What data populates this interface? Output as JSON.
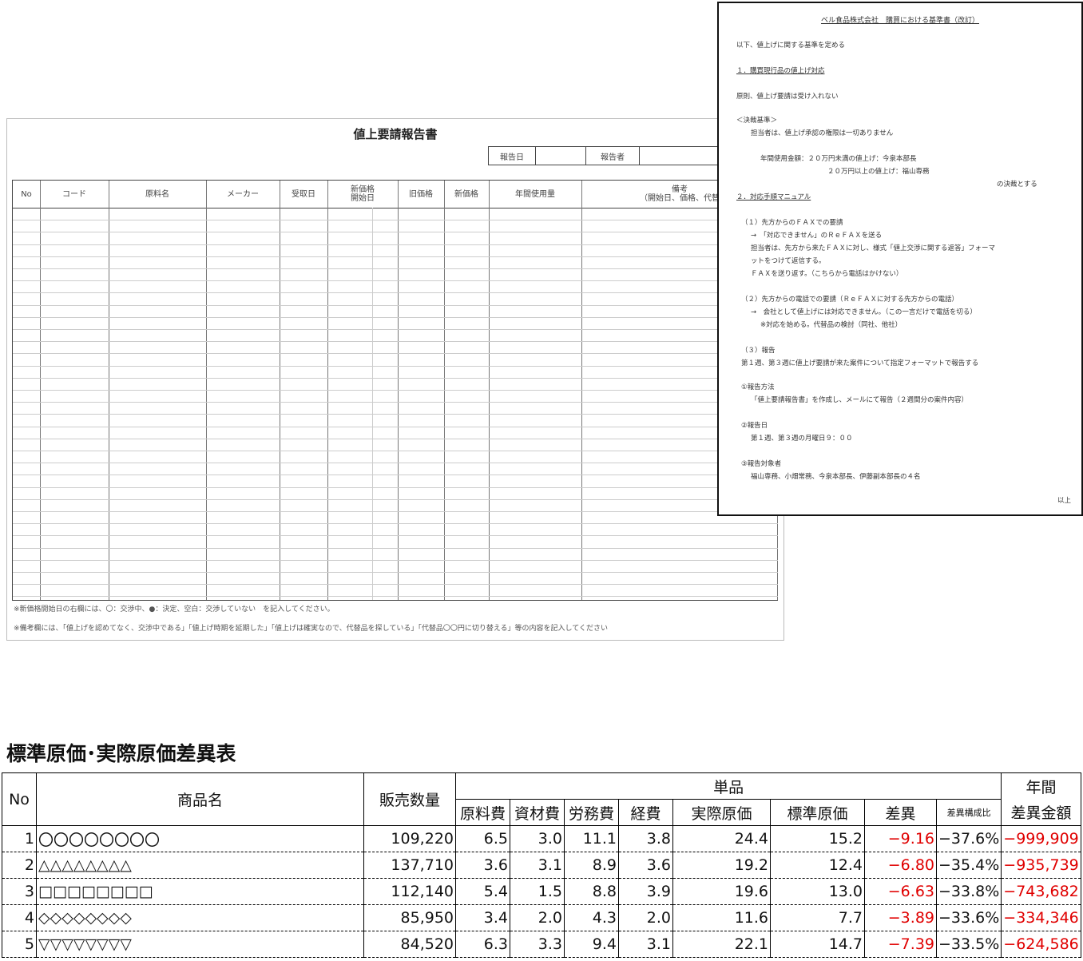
{
  "form": {
    "title": "値上要請報告書",
    "report_date_label": "報告日",
    "reporter_label": "報告者",
    "columns": [
      "No",
      "コード",
      "原料名",
      "メーカー",
      "受取日",
      "新価格\n開始日",
      "旧価格",
      "新価格",
      "年間使用量",
      "備考\n（開始日、価格、代替"
    ],
    "note1": "※新価格開始日の右欄には、〇：交渉中、●：決定、空白：交渉していない　を記入してください。",
    "note2": "※備考欄には、「値上げを認めてなく、交渉中である」「値上げ時期を延期した」「値上げは確実なので、代替品を探している」「代替品〇〇円に切り替える」等の内容を記入してください"
  },
  "doc": {
    "title": "ベル食品株式会社　購買における基準書（改訂）",
    "lines": [
      "以下、値上げに関する基準を定める",
      "１．購買現行品の値上げ対応",
      "原則、値上げ要請は受け入れない",
      "＜決裁基準＞",
      "担当者は、値上げ承認の権限は一切ありません",
      "年間使用金額：２０万円未満の値上げ：今泉本部長",
      "２０万円以上の値上げ：福山専務",
      "の決裁とする",
      "２．対応手順マニュアル",
      "（１）先方からのＦＡＸでの要請",
      "→　「対応できません」のＲｅＦＡＸを送る",
      "担当者は、先方から来たＦＡＸに対し、様式「値上交渉に関する返答」フォーマ",
      "ットをつけて返信する。",
      "ＦＡＸを送り返す。（こちらから電話はかけない）",
      "（２）先方からの電話での要請（ＲｅＦＡＸに対する先方からの電話）",
      "→　会社として値上げには対応できません。（この一言だけで電話を切る）",
      "※対応を始める。代替品の検討（同社、他社）",
      "（３）報告",
      "第１週、第３週に値上げ要請が来た案件について指定フォーマットで報告する",
      "①報告方法",
      "「値上要請報告書」を作成し、メールにて報告（２週間分の案件内容）",
      "②報告日",
      "第１週、第３週の月曜日９：００",
      "③報告対象者",
      "福山専務、小畑常務、今泉本部長、伊藤副本部長の４名",
      "以上"
    ]
  },
  "table": {
    "title": "標準原価･実際原価差異表",
    "headers": {
      "no": "No",
      "product": "商品名",
      "qty": "販売数量",
      "unit": "単品",
      "material": "原料費",
      "supplies": "資材費",
      "labor": "労務費",
      "expense": "経費",
      "actual": "実際原価",
      "standard": "標準原価",
      "diff": "差異",
      "ratio": "差異構成比",
      "annual_top": "年間",
      "annual": "差異金額"
    },
    "rows": [
      {
        "no": "1",
        "name": "〇〇〇〇〇〇〇〇",
        "qty": "109,220",
        "material": "6.5",
        "supplies": "3.0",
        "labor": "11.1",
        "expense": "3.8",
        "actual": "24.4",
        "standard": "15.2",
        "diff": "−9.16",
        "ratio": "−37.6%",
        "amount": "−999,909"
      },
      {
        "no": "2",
        "name": "△△△△△△△△",
        "qty": "137,710",
        "material": "3.6",
        "supplies": "3.1",
        "labor": "8.9",
        "expense": "3.6",
        "actual": "19.2",
        "standard": "12.4",
        "diff": "−6.80",
        "ratio": "−35.4%",
        "amount": "−935,739"
      },
      {
        "no": "3",
        "name": "□□□□□□□□",
        "qty": "112,140",
        "material": "5.4",
        "supplies": "1.5",
        "labor": "8.8",
        "expense": "3.9",
        "actual": "19.6",
        "standard": "13.0",
        "diff": "−6.63",
        "ratio": "−33.8%",
        "amount": "−743,682"
      },
      {
        "no": "4",
        "name": "◇◇◇◇◇◇◇◇",
        "qty": "85,950",
        "material": "3.4",
        "supplies": "2.0",
        "labor": "4.3",
        "expense": "2.0",
        "actual": "11.6",
        "standard": "7.7",
        "diff": "−3.89",
        "ratio": "−33.6%",
        "amount": "−334,346"
      },
      {
        "no": "5",
        "name": "▽▽▽▽▽▽▽▽",
        "qty": "84,520",
        "material": "6.3",
        "supplies": "3.3",
        "labor": "9.4",
        "expense": "3.1",
        "actual": "22.1",
        "standard": "14.7",
        "diff": "−7.39",
        "ratio": "−33.5%",
        "amount": "−624,586"
      }
    ]
  }
}
